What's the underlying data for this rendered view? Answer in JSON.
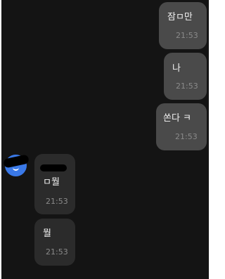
{
  "messages": [
    {
      "direction": "outgoing",
      "text": "잠ㅁ만",
      "time": "21:53"
    },
    {
      "direction": "outgoing",
      "text": "나",
      "time": "21:53"
    },
    {
      "direction": "outgoing",
      "text": "쏜다 ㅋ",
      "time": "21:53"
    },
    {
      "direction": "incoming",
      "text": "ㅁ뭘",
      "time": "21:53"
    },
    {
      "direction": "incoming",
      "text": "뭘",
      "time": "21:53"
    }
  ],
  "colors": {
    "background": "#141414",
    "outgoing_bubble": "#4a4a4a",
    "incoming_bubble": "#2b2b2b",
    "avatar": "#3a79e8",
    "time_text": "#8a8a8a"
  },
  "icons": {
    "avatar": "profile-avatar-icon"
  }
}
